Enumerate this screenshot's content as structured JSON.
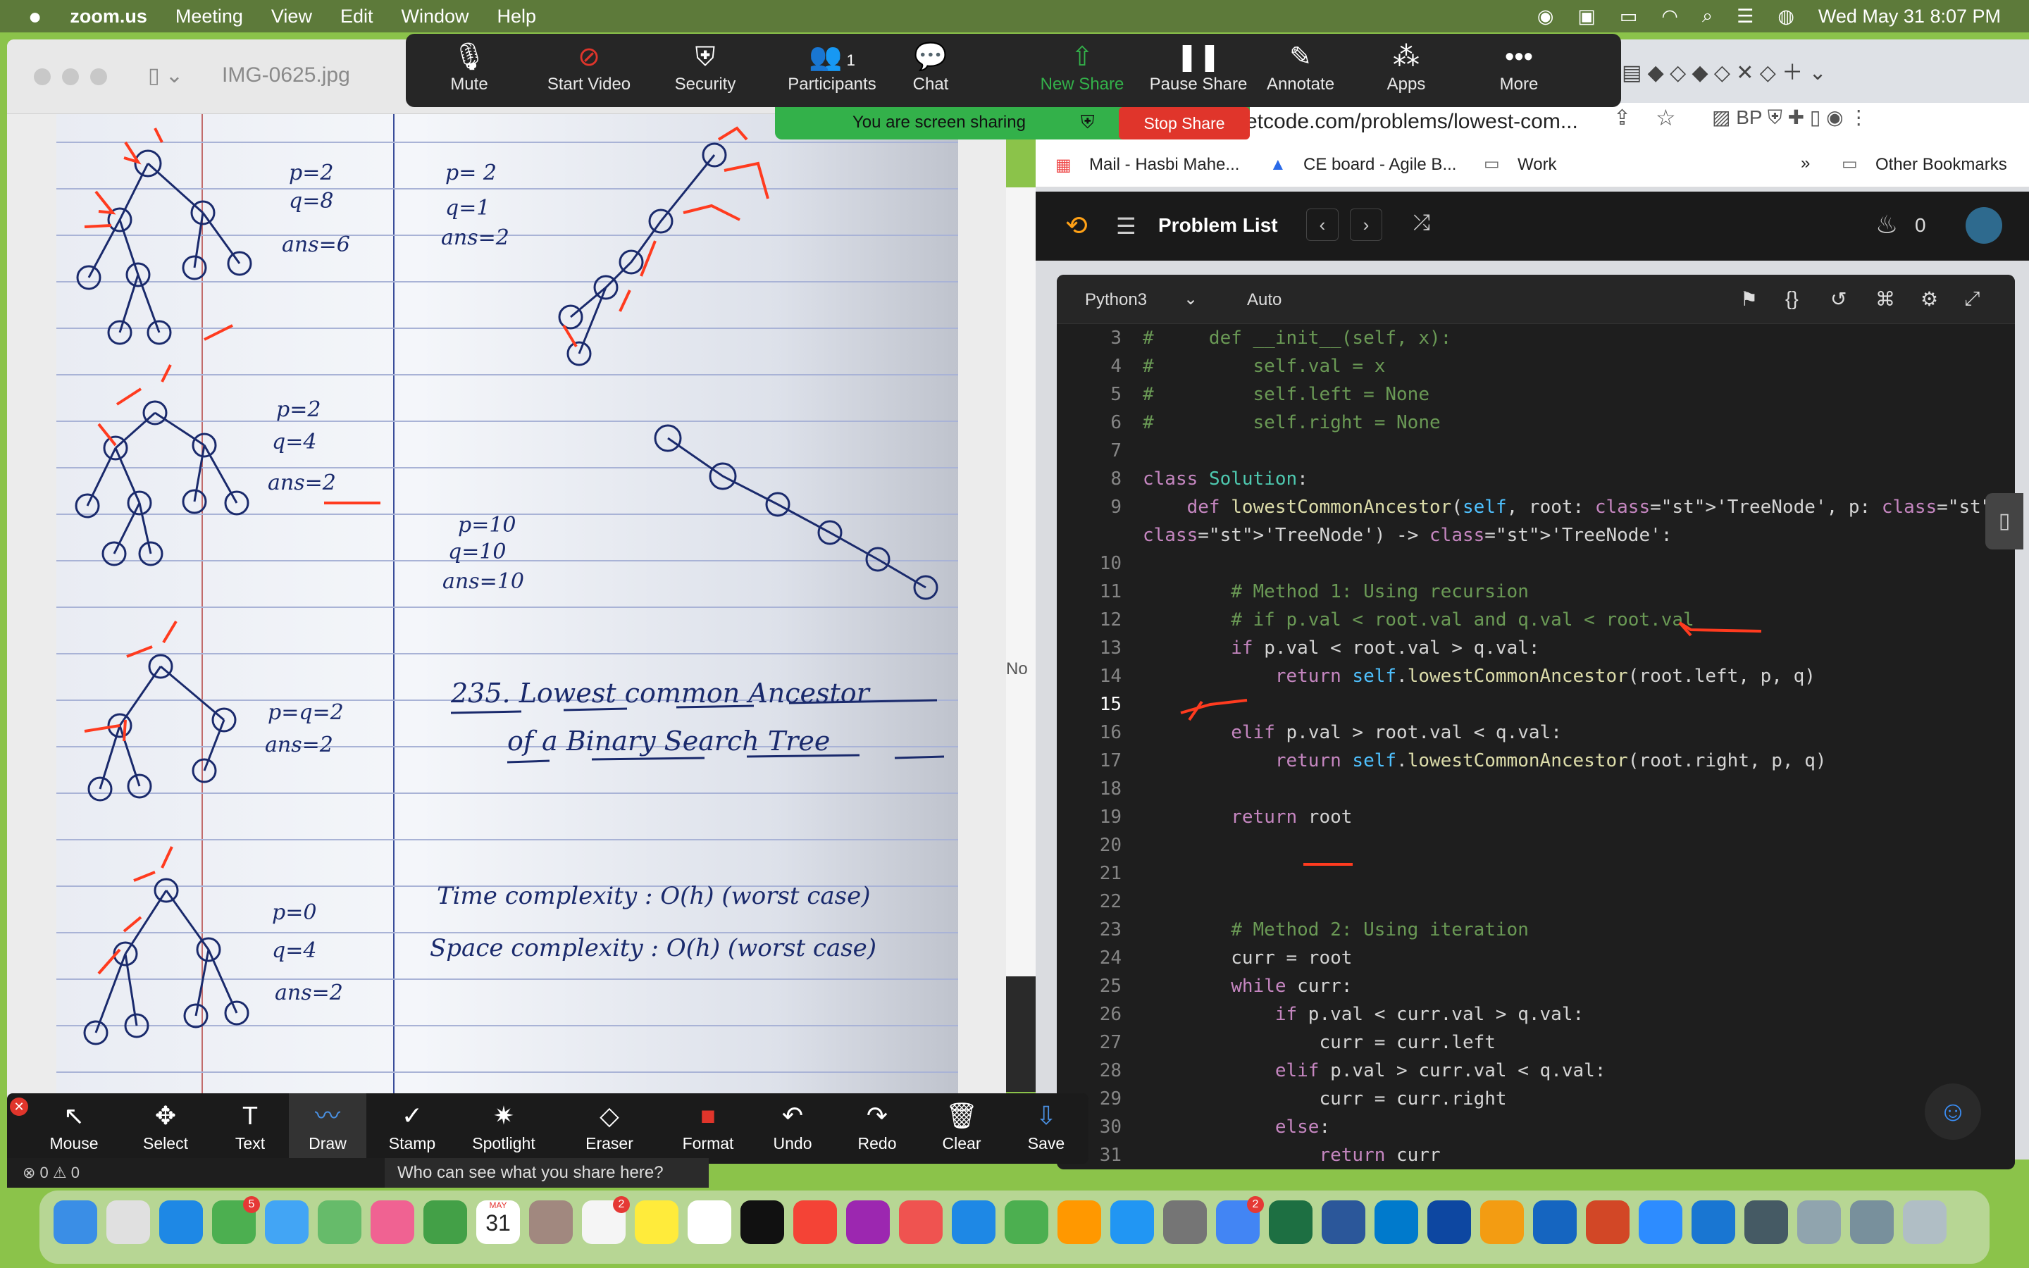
{
  "menubar": {
    "apple": "",
    "app_name": "zoom.us",
    "menus": [
      "Meeting",
      "View",
      "Edit",
      "Window",
      "Help"
    ],
    "datetime": "Wed May 31  8:07 PM"
  },
  "viewer": {
    "title": "IMG-0625.jpg"
  },
  "notebook": {
    "blocks": [
      {
        "p": "p=2",
        "q": "q=8",
        "ans": "ans=6"
      },
      {
        "p": "p= 2",
        "q": "q=1",
        "ans": "ans=2"
      },
      {
        "p": "p=2",
        "q": "q=4",
        "ans": "ans=2"
      },
      {
        "p": "p=10",
        "q": "q=10",
        "ans": "ans=10"
      },
      {
        "p": "p=q=2",
        "q": "",
        "ans": "ans=2"
      },
      {
        "p": "p=0",
        "q": "q=4",
        "ans": "ans=2"
      }
    ],
    "title_line1": "235. Lowest common Ancestor",
    "title_line2": "of a Binary Search Tree",
    "time_complexity": "Time complexity : O(h) (worst case)",
    "space_complexity": "Space complexity : O(h) (worst case)"
  },
  "zoom_toolbar": {
    "buttons": [
      {
        "label": "Mute",
        "icon": "microphone-icon"
      },
      {
        "label": "Start Video",
        "icon": "video-off-icon"
      },
      {
        "label": "Security",
        "icon": "shield-icon"
      },
      {
        "label": "Participants",
        "icon": "participants-icon",
        "count": "1"
      },
      {
        "label": "Chat",
        "icon": "chat-icon"
      },
      {
        "label": "New Share",
        "icon": "share-icon"
      },
      {
        "label": "Pause Share",
        "icon": "pause-icon"
      },
      {
        "label": "Annotate",
        "icon": "pencil-icon"
      },
      {
        "label": "Apps",
        "icon": "apps-icon"
      },
      {
        "label": "More",
        "icon": "more-icon"
      }
    ],
    "sharing_banner": "You are screen sharing",
    "stop_share": "Stop Share"
  },
  "browser": {
    "url": "etcode.com/problems/lowest-com...",
    "bookmarks": [
      "Mail - Hasbi Mahe...",
      "CE board - Agile B...",
      "Work"
    ],
    "bookmarks_more": "»",
    "other_bookmarks": "Other Bookmarks"
  },
  "leetcode": {
    "problem_list": "Problem List",
    "streak": "0",
    "language": "Python3",
    "auto": "Auto",
    "code_lines": [
      {
        "n": "3",
        "t": "#     def __init__(self, x):"
      },
      {
        "n": "4",
        "t": "#         self.val = x"
      },
      {
        "n": "5",
        "t": "#         self.left = None"
      },
      {
        "n": "6",
        "t": "#         self.right = None"
      },
      {
        "n": "7",
        "t": ""
      },
      {
        "n": "8",
        "t": "class Solution:"
      },
      {
        "n": "9",
        "t": "    def lowestCommonAncestor(self, root: 'TreeNode', p: 'TreeNode', q:"
      },
      {
        "n": "",
        "t": "'TreeNode') -> 'TreeNode':"
      },
      {
        "n": "10",
        "t": ""
      },
      {
        "n": "11",
        "t": "        # Method 1: Using recursion"
      },
      {
        "n": "12",
        "t": "        # if p.val < root.val and q.val < root.val"
      },
      {
        "n": "13",
        "t": "        if p.val < root.val > q.val:"
      },
      {
        "n": "14",
        "t": "            return self.lowestCommonAncestor(root.left, p, q)"
      },
      {
        "n": "15",
        "t": ""
      },
      {
        "n": "16",
        "t": "        elif p.val > root.val < q.val:"
      },
      {
        "n": "17",
        "t": "            return self.lowestCommonAncestor(root.right, p, q)"
      },
      {
        "n": "18",
        "t": ""
      },
      {
        "n": "19",
        "t": "        return root"
      },
      {
        "n": "20",
        "t": ""
      },
      {
        "n": "21",
        "t": ""
      },
      {
        "n": "22",
        "t": ""
      },
      {
        "n": "23",
        "t": "        # Method 2: Using iteration"
      },
      {
        "n": "24",
        "t": "        curr = root"
      },
      {
        "n": "25",
        "t": "        while curr:"
      },
      {
        "n": "26",
        "t": "            if p.val < curr.val > q.val:"
      },
      {
        "n": "27",
        "t": "                curr = curr.left"
      },
      {
        "n": "28",
        "t": "            elif p.val > curr.val < q.val:"
      },
      {
        "n": "29",
        "t": "                curr = curr.right"
      },
      {
        "n": "30",
        "t": "            else:"
      },
      {
        "n": "31",
        "t": "                return curr"
      }
    ]
  },
  "annotate_toolbar": {
    "tools": [
      "Mouse",
      "Select",
      "Text",
      "Draw",
      "Stamp",
      "Spotlight",
      "Eraser",
      "Format",
      "Undo",
      "Redo",
      "Clear",
      "Save"
    ],
    "who_can_see": "Who can see what you share here?",
    "problems": "⊗ 0  ⚠ 0",
    "side_note": "No"
  },
  "colors": {
    "zoom_bar": "#262626",
    "share_green": "#33b14a",
    "stop_red": "#e0352b",
    "desktop_green": "#8bc34a",
    "editor_bg": "#1e1e1e",
    "ink_blue": "#1a2a6c",
    "annot_red": "#ff3b1f"
  },
  "dock": {
    "calendar_month": "MAY",
    "calendar_day": "31",
    "messages_badge": "5",
    "reminders_badge": "2",
    "chrome_badge": "2"
  }
}
